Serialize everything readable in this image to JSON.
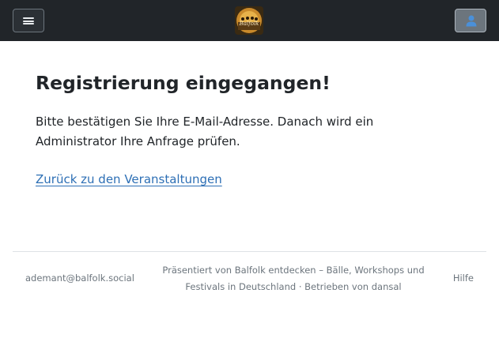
{
  "header": {
    "menu_icon": "hamburger-menu-icon",
    "logo_text": "Balfolk",
    "user_icon": "user-icon"
  },
  "main": {
    "title": "Registrierung eingegangen!",
    "message": "Bitte bestätigen Sie Ihre E-Mail-Adresse. Danach wird ein Administrator Ihre Anfrage prüfen.",
    "back_link": "Zurück zu den Veranstaltungen"
  },
  "footer": {
    "email": "ademant@balfolk.social",
    "presented_by": "Präsentiert von ",
    "site_name": "Balfolk entdecken – Bälle, Workshops und Festivals in Deutschland",
    "separator": " · ",
    "powered_by": "Betrieben von dansal",
    "help": "Hilfe"
  },
  "colors": {
    "topbar": "#212529",
    "link": "#2d6fb5",
    "muted": "#6c757d"
  }
}
